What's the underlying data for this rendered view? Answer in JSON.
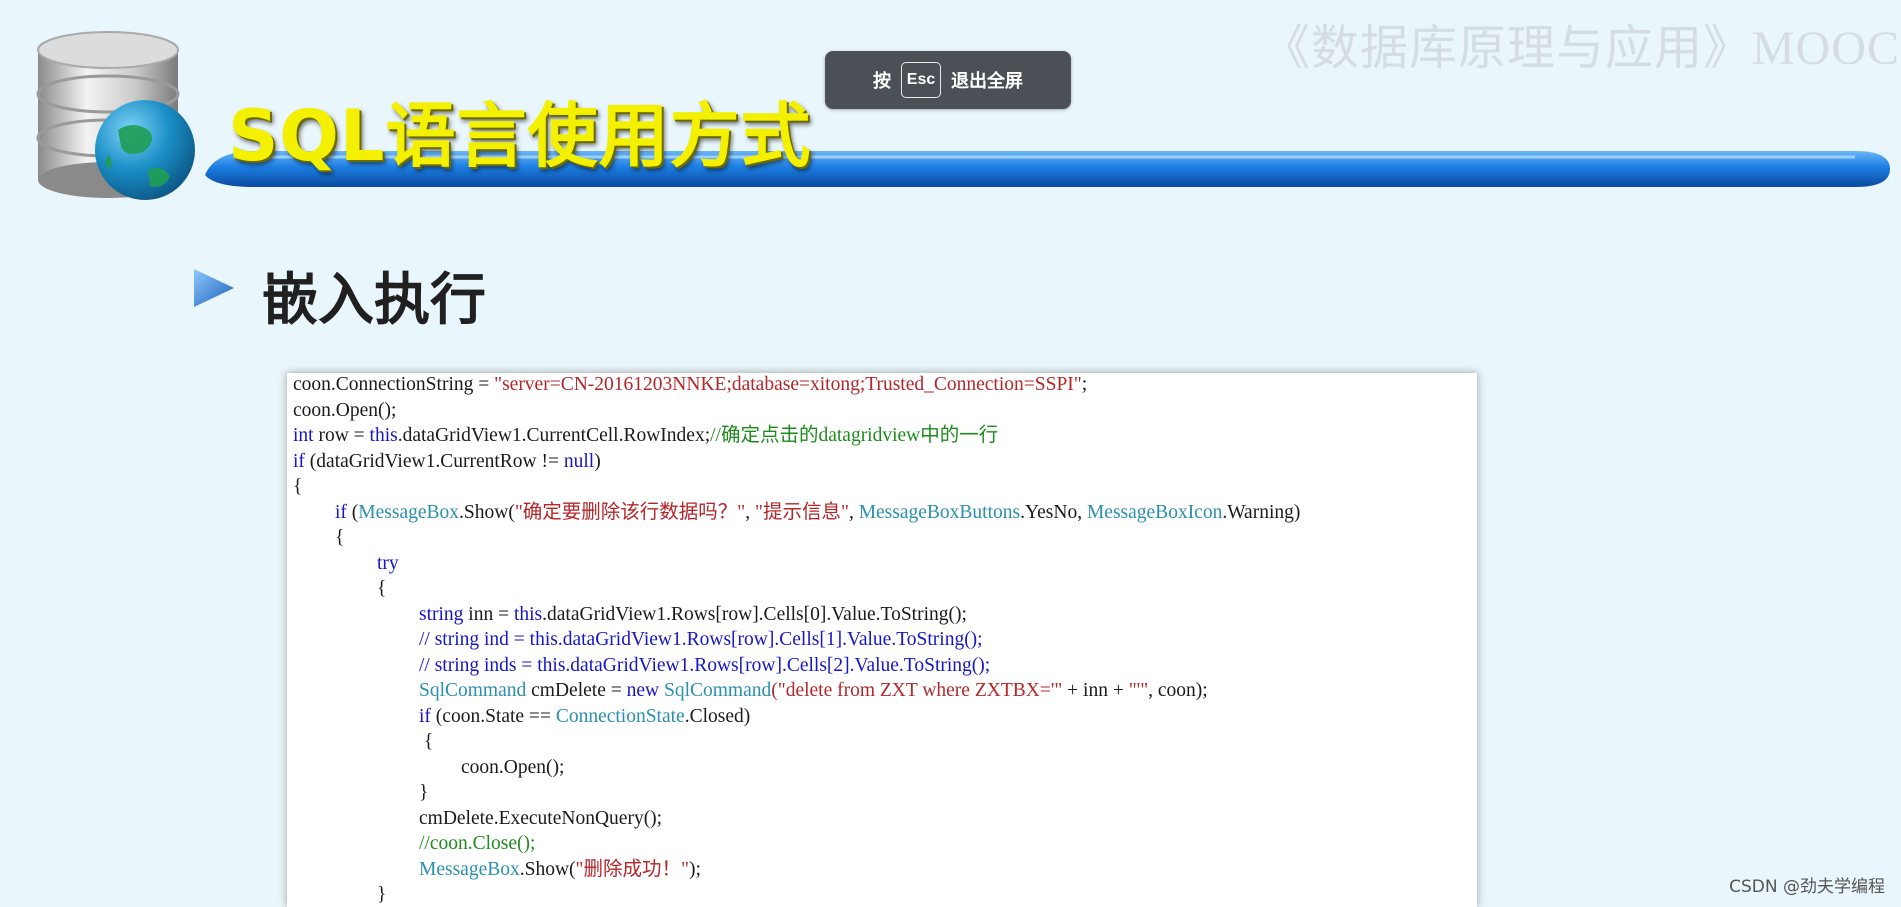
{
  "watermark": "《数据库原理与应用》MOOC",
  "esc_toast": {
    "press": "按",
    "key": "Esc",
    "exit": "退出全屏"
  },
  "slide": {
    "title": "SQL语言使用方式",
    "section_heading": "嵌入执行"
  },
  "code_lines": [
    {
      "indent": 0,
      "tokens": [
        [
          "p",
          "coon.ConnectionString = "
        ],
        [
          "s",
          "\"server=CN-20161203NNKE;database=xitong;Trusted_Connection=SSPI\""
        ],
        [
          "p",
          ";"
        ]
      ]
    },
    {
      "indent": 0,
      "tokens": [
        [
          "p",
          "coon.Open();"
        ]
      ]
    },
    {
      "indent": 0,
      "tokens": [
        [
          "k",
          "int"
        ],
        [
          "p",
          " row = "
        ],
        [
          "k",
          "this"
        ],
        [
          "p",
          ".dataGridView1.CurrentCell.RowIndex;"
        ],
        [
          "c",
          "//确定点击的datagridview中的一行"
        ]
      ]
    },
    {
      "indent": 0,
      "tokens": [
        [
          "k",
          "if"
        ],
        [
          "p",
          " (dataGridView1.CurrentRow != "
        ],
        [
          "k",
          "null"
        ],
        [
          "p",
          ")"
        ]
      ]
    },
    {
      "indent": 0,
      "tokens": [
        [
          "p",
          "{"
        ]
      ]
    },
    {
      "indent": 1,
      "tokens": [
        [
          "k",
          "if"
        ],
        [
          "p",
          " ("
        ],
        [
          "t",
          "MessageBox"
        ],
        [
          "p",
          ".Show("
        ],
        [
          "s",
          "\"确定要删除该行数据吗？\""
        ],
        [
          "p",
          ", "
        ],
        [
          "s",
          "\"提示信息\""
        ],
        [
          "p",
          ", "
        ],
        [
          "t",
          "MessageBoxButtons"
        ],
        [
          "p",
          ".YesNo, "
        ],
        [
          "t",
          "MessageBoxIcon"
        ],
        [
          "p",
          ".Warning)"
        ]
      ]
    },
    {
      "indent": 1,
      "tokens": [
        [
          "p",
          "{"
        ]
      ]
    },
    {
      "indent": 2,
      "tokens": [
        [
          "k",
          "try"
        ]
      ]
    },
    {
      "indent": 2,
      "tokens": [
        [
          "p",
          "{"
        ]
      ]
    },
    {
      "indent": 3,
      "tokens": [
        [
          "k",
          "string"
        ],
        [
          "p",
          " inn = "
        ],
        [
          "k",
          "this"
        ],
        [
          "p",
          ".dataGridView1.Rows[row].Cells[0].Value.ToString();"
        ]
      ]
    },
    {
      "indent": 3,
      "tokens": [
        [
          "k",
          "// string ind = this.dataGridView1.Rows[row].Cells[1].Value.ToString();"
        ]
      ]
    },
    {
      "indent": 3,
      "tokens": [
        [
          "k",
          "// string inds = this.dataGridView1.Rows[row].Cells[2].Value.ToString();"
        ]
      ]
    },
    {
      "indent": 3,
      "tokens": [
        [
          "t",
          "SqlCommand"
        ],
        [
          "p",
          " cmDelete = "
        ],
        [
          "k",
          "new"
        ],
        [
          "p",
          " "
        ],
        [
          "t",
          "SqlCommand"
        ],
        [
          "s",
          "(\"delete from ZXT where ZXTBX='\""
        ],
        [
          "p",
          " + inn + "
        ],
        [
          "s",
          "\"'\""
        ],
        [
          "p",
          ", coon);"
        ]
      ]
    },
    {
      "indent": 3,
      "tokens": [
        [
          "k",
          "if"
        ],
        [
          "p",
          " (coon.State == "
        ],
        [
          "t",
          "ConnectionState"
        ],
        [
          "p",
          ".Closed)"
        ]
      ]
    },
    {
      "indent": 3,
      "tokens": [
        [
          "p",
          " {"
        ]
      ]
    },
    {
      "indent": 4,
      "tokens": [
        [
          "p",
          "coon.Open();"
        ]
      ]
    },
    {
      "indent": 3,
      "tokens": [
        [
          "p",
          "}"
        ]
      ]
    },
    {
      "indent": 3,
      "tokens": [
        [
          "p",
          "cmDelete.ExecuteNonQuery();"
        ]
      ]
    },
    {
      "indent": 3,
      "tokens": [
        [
          "c",
          "//coon.Close();"
        ]
      ]
    },
    {
      "indent": 3,
      "tokens": [
        [
          "t",
          "MessageBox"
        ],
        [
          "p",
          ".Show("
        ],
        [
          "s",
          "\"删除成功！\""
        ],
        [
          "p",
          ");"
        ]
      ]
    },
    {
      "indent": 2,
      "tokens": [
        [
          "p",
          "}"
        ]
      ]
    }
  ],
  "footer": {
    "csdn_credit": "CSDN @劲夫学编程"
  }
}
